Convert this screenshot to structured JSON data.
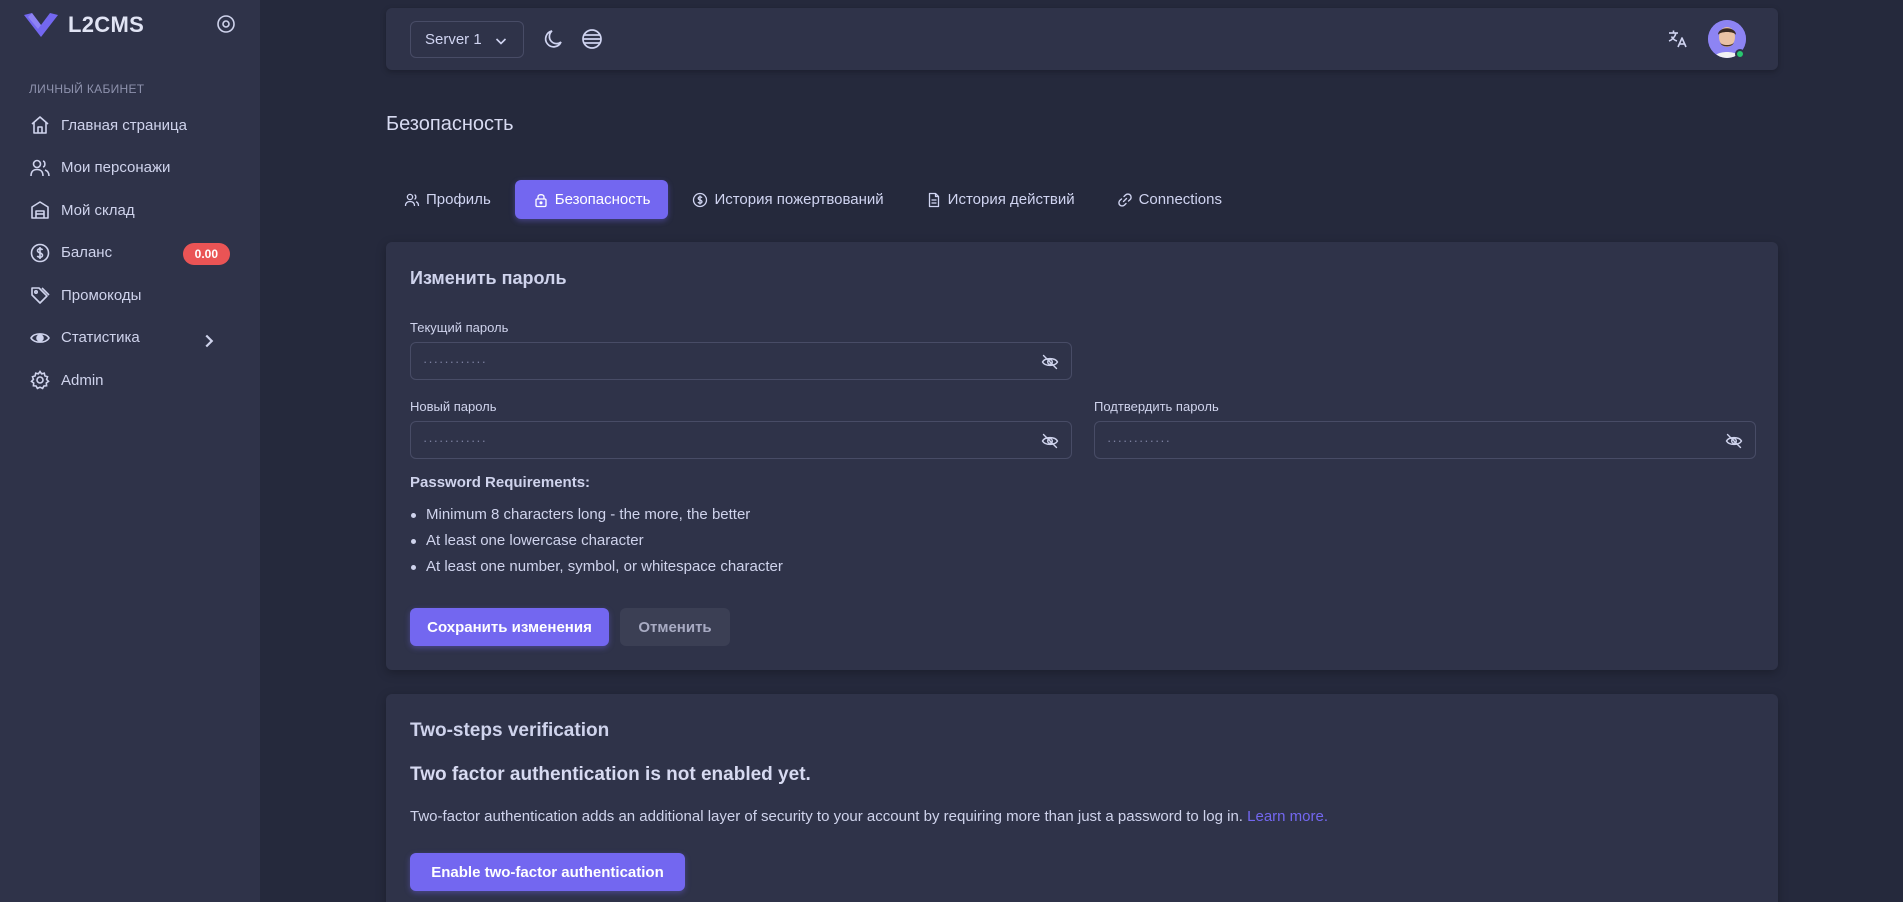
{
  "brand": {
    "name": "L2CMS"
  },
  "sidebar": {
    "section_header": "ЛИЧНЫЙ КАБИНЕТ",
    "items": [
      {
        "label": "Главная страница",
        "icon": "home-icon"
      },
      {
        "label": "Мои персонажи",
        "icon": "users-icon"
      },
      {
        "label": "Мой склад",
        "icon": "warehouse-icon"
      },
      {
        "label": "Баланс",
        "icon": "dollar-circle-icon",
        "badge": "0.00"
      },
      {
        "label": "Промокоды",
        "icon": "tags-icon"
      },
      {
        "label": "Статистика",
        "icon": "chart-eye-icon",
        "has_submenu": true
      },
      {
        "label": "Admin",
        "icon": "gear-icon"
      }
    ]
  },
  "navbar": {
    "server_select": "Server 1",
    "icons": [
      "moon-icon",
      "globe-icon",
      "translate-icon",
      "avatar"
    ]
  },
  "page": {
    "title": "Безопасность"
  },
  "tabs": [
    {
      "label": "Профиль",
      "icon": "users-icon",
      "active": false
    },
    {
      "label": "Безопасность",
      "icon": "lock-icon",
      "active": true
    },
    {
      "label": "История пожертвований",
      "icon": "dollar-circle-icon",
      "active": false
    },
    {
      "label": "История действий",
      "icon": "file-icon",
      "active": false
    },
    {
      "label": "Connections",
      "icon": "link-icon",
      "active": false
    }
  ],
  "password_card": {
    "title": "Изменить пароль",
    "current_label": "Текущий пароль",
    "current_value": "············",
    "new_label": "Новый пароль",
    "new_value": "············",
    "confirm_label": "Подтвердить пароль",
    "confirm_value": "············",
    "requirements_title": "Password Requirements:",
    "requirements": [
      "Minimum 8 characters long - the more, the better",
      "At least one lowercase character",
      "At least one number, symbol, or whitespace character"
    ],
    "save_label": "Сохранить изменения",
    "cancel_label": "Отменить"
  },
  "tfa_card": {
    "title": "Two-steps verification",
    "heading": "Two factor authentication is not enabled yet.",
    "text": "Two-factor authentication adds an additional layer of security to your account by requiring more than just a password to log in.",
    "link": "Learn more.",
    "button_label": "Enable two-factor authentication"
  },
  "colors": {
    "primary": "#7367f0",
    "background": "#25293c",
    "surface": "#2f3349",
    "badge": "#ea5455",
    "online": "#28c76f"
  }
}
